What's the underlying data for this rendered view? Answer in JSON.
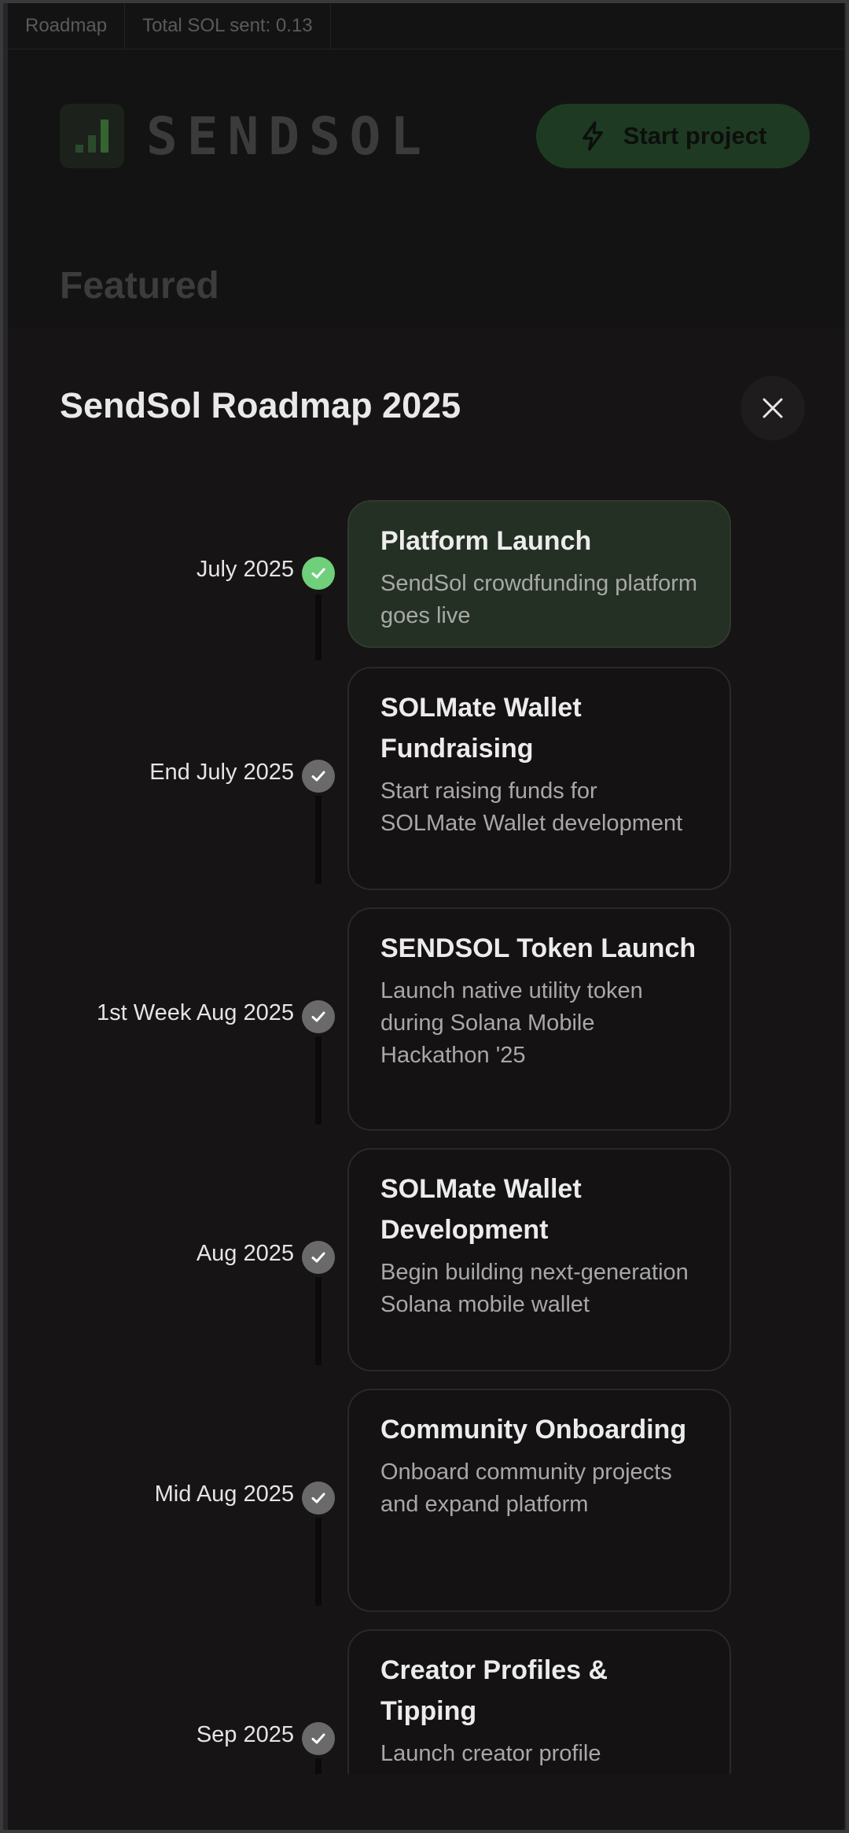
{
  "topbar": {
    "tab_label": "Roadmap",
    "sol_sent_label": "Total SOL sent: 0.13"
  },
  "header": {
    "logo_text": "SENDSOL",
    "start_project_label": "Start project"
  },
  "background": {
    "section_title": "Featured"
  },
  "modal": {
    "title": "SendSol Roadmap 2025",
    "close_icon": "close-icon",
    "milestones": [
      {
        "date": "July 2025",
        "title": "Platform Launch",
        "description": "SendSol crowdfunding platform goes live",
        "status": "completed"
      },
      {
        "date": "End July 2025",
        "title": "SOLMate Wallet Fundraising",
        "description": "Start raising funds for SOLMate Wallet development",
        "status": "pending"
      },
      {
        "date": "1st Week Aug 2025",
        "title": "SENDSOL Token Launch",
        "description": "Launch native utility token during Solana Mobile Hackathon '25",
        "status": "pending"
      },
      {
        "date": "Aug 2025",
        "title": "SOLMate Wallet Development",
        "description": "Begin building next-generation Solana mobile wallet",
        "status": "pending"
      },
      {
        "date": "Mid Aug 2025",
        "title": "Community Onboarding",
        "description": "Onboard community projects and expand platform",
        "status": "pending"
      },
      {
        "date": "Sep 2025",
        "title": "Creator Profiles & Tipping",
        "description": "Launch creator profile",
        "status": "pending"
      }
    ]
  },
  "colors": {
    "accent_green": "#6fcf7a",
    "active_card": "#243023",
    "pending_check": "#6b6a6b"
  }
}
